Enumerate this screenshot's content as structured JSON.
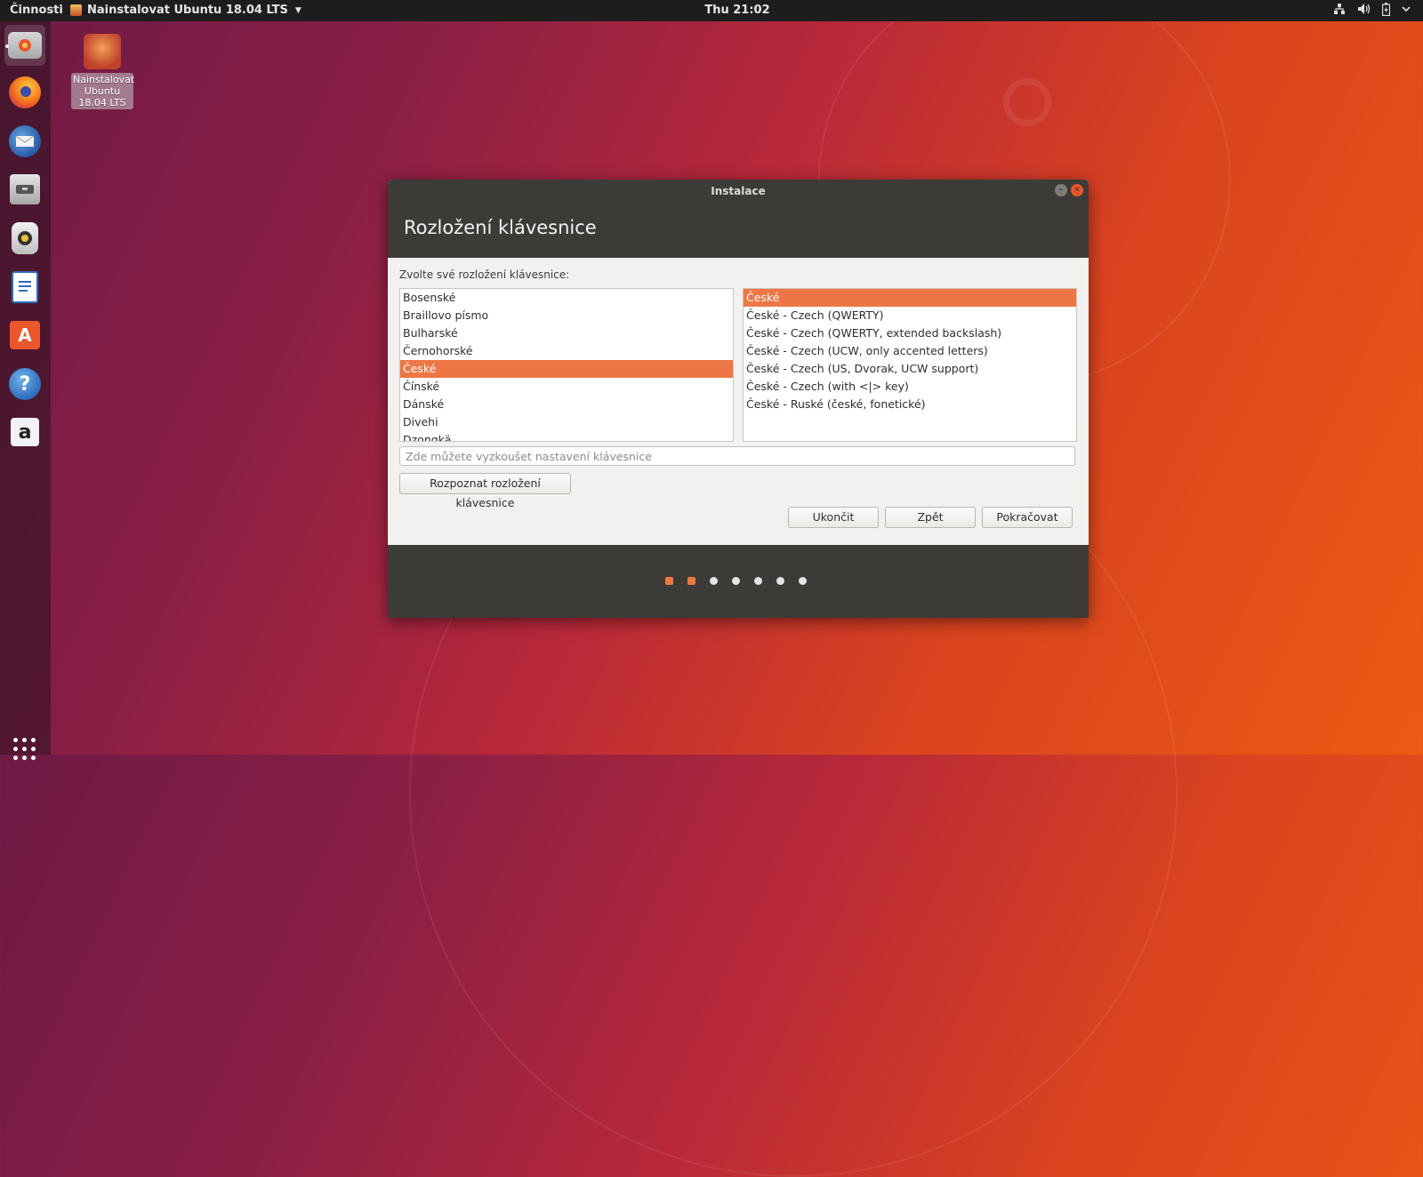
{
  "topbar": {
    "activities": "Činnosti",
    "app_menu": "Nainstalovat Ubuntu 18.04 LTS",
    "clock": "Thu 21:02",
    "tray_icons": [
      "network-icon",
      "volume-icon",
      "battery-icon",
      "power-menu-icon"
    ]
  },
  "dock": {
    "items": [
      {
        "name": "ubuntu-installer",
        "active": true
      },
      {
        "name": "firefox"
      },
      {
        "name": "thunderbird"
      },
      {
        "name": "files"
      },
      {
        "name": "rhythmbox"
      },
      {
        "name": "libreoffice-writer"
      },
      {
        "name": "ubuntu-software"
      },
      {
        "name": "help"
      },
      {
        "name": "amazon"
      }
    ]
  },
  "desktop": {
    "icon_label": "Nainstalovat Ubuntu 18.04 LTS"
  },
  "window": {
    "title": "Instalace",
    "heading": "Rozložení klávesnice",
    "prompt": "Zvolte své rozložení klávesnice:",
    "layouts": [
      {
        "label": "Bosenské"
      },
      {
        "label": "Braillovo písmo"
      },
      {
        "label": "Bulharské"
      },
      {
        "label": "Černohorské"
      },
      {
        "label": "České",
        "selected": true
      },
      {
        "label": "Čínské"
      },
      {
        "label": "Dánské"
      },
      {
        "label": "Divehi"
      },
      {
        "label": "Dzongkä"
      }
    ],
    "variants": [
      {
        "label": "České",
        "selected": true
      },
      {
        "label": "České - Czech (QWERTY)"
      },
      {
        "label": "České - Czech (QWERTY, extended backslash)"
      },
      {
        "label": "České - Czech (UCW, only accented letters)"
      },
      {
        "label": "České - Czech (US, Dvorak, UCW support)"
      },
      {
        "label": "České - Czech (with <|> key)"
      },
      {
        "label": "České - Ruské (české, fonetické)"
      }
    ],
    "test_placeholder": "Zde můžete vyzkoušet nastavení klávesnice",
    "test_value": "",
    "detect_button": "Rozpoznat rozložení klávesnice",
    "quit_button": "Ukončit",
    "back_button": "Zpět",
    "continue_button": "Pokračovat",
    "progress": {
      "total_steps": 7,
      "completed_steps": 2
    }
  },
  "colors": {
    "accent": "#ee7645",
    "titlebar": "#3c3b37",
    "topbar": "#1d1d1d"
  }
}
